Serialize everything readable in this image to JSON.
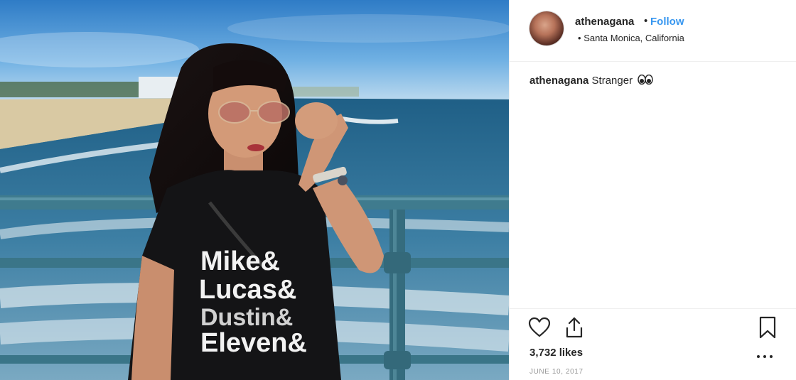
{
  "post": {
    "username": "athenagana",
    "separator": "•",
    "follow_label": "Follow",
    "location_bullet": "•",
    "location": "Santa Monica, California",
    "caption_user": "athenagana",
    "caption_text": "Stranger",
    "caption_emoji": "eyes-icon",
    "likes": "3,732 likes",
    "date": "JUNE 10, 2017",
    "photo_shirt_text": [
      "Mike&",
      "Lucas&",
      "Dustin&",
      "Eleven&"
    ]
  },
  "icons": {
    "like": "heart-icon",
    "share": "share-icon",
    "save": "bookmark-icon",
    "more": "more-options-icon"
  },
  "colors": {
    "follow": "#3897f0",
    "text": "#262626",
    "muted": "#999999"
  }
}
